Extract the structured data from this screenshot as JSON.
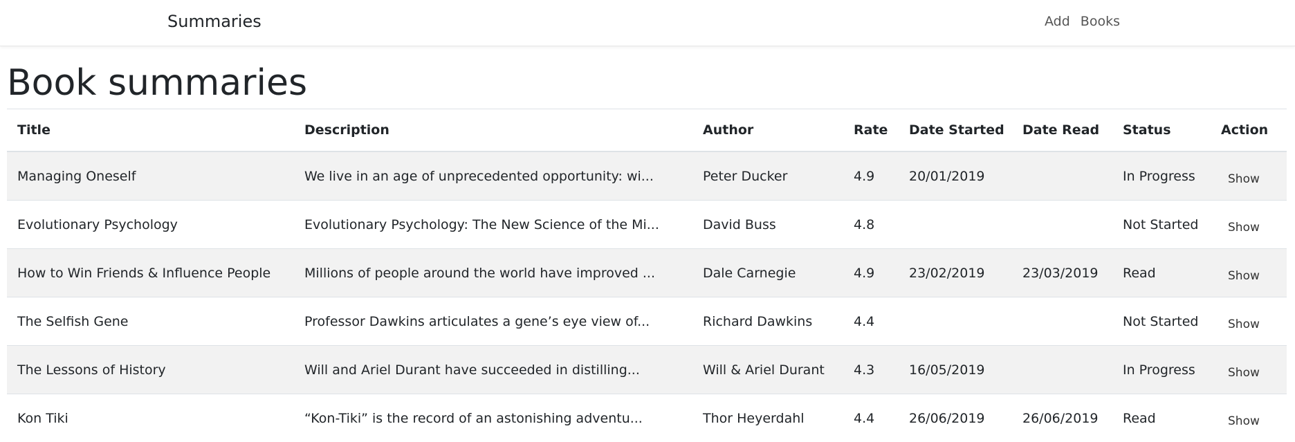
{
  "navbar": {
    "brand": "Summaries",
    "links": [
      {
        "label": "Add"
      },
      {
        "label": "Books"
      }
    ]
  },
  "page_title": "Book summaries",
  "table": {
    "columns": [
      "Title",
      "Description",
      "Author",
      "Rate",
      "Date Started",
      "Date Read",
      "Status",
      "Action"
    ],
    "rows": [
      {
        "title": "Managing Oneself",
        "description": "We live in an age of unprecedented opportunity: wi...",
        "author": "Peter Ducker",
        "rate": "4.9",
        "date_started": "20/01/2019",
        "date_read": "",
        "status": "In Progress",
        "action": "Show"
      },
      {
        "title": "Evolutionary Psychology",
        "description": "Evolutionary Psychology: The New Science of the Mi...",
        "author": "David Buss",
        "rate": "4.8",
        "date_started": "",
        "date_read": "",
        "status": "Not Started",
        "action": "Show"
      },
      {
        "title": "How to Win Friends & Influence People",
        "description": "Millions of people around the world have improved ...",
        "author": "Dale Carnegie",
        "rate": "4.9",
        "date_started": "23/02/2019",
        "date_read": "23/03/2019",
        "status": "Read",
        "action": "Show"
      },
      {
        "title": "The Selfish Gene",
        "description": "Professor Dawkins articulates a gene’s eye view of...",
        "author": "Richard Dawkins",
        "rate": "4.4",
        "date_started": "",
        "date_read": "",
        "status": "Not Started",
        "action": "Show"
      },
      {
        "title": "The Lessons of History",
        "description": "Will and Ariel Durant have succeeded in distilling...",
        "author": "Will & Ariel Durant",
        "rate": "4.3",
        "date_started": "16/05/2019",
        "date_read": "",
        "status": "In Progress",
        "action": "Show"
      },
      {
        "title": "Kon Tiki",
        "description": "“Kon-Tiki” is the record of an astonishing adventu...",
        "author": "Thor Heyerdahl",
        "rate": "4.4",
        "date_started": "26/06/2019",
        "date_read": "26/06/2019",
        "status": "Read",
        "action": "Show"
      }
    ]
  }
}
